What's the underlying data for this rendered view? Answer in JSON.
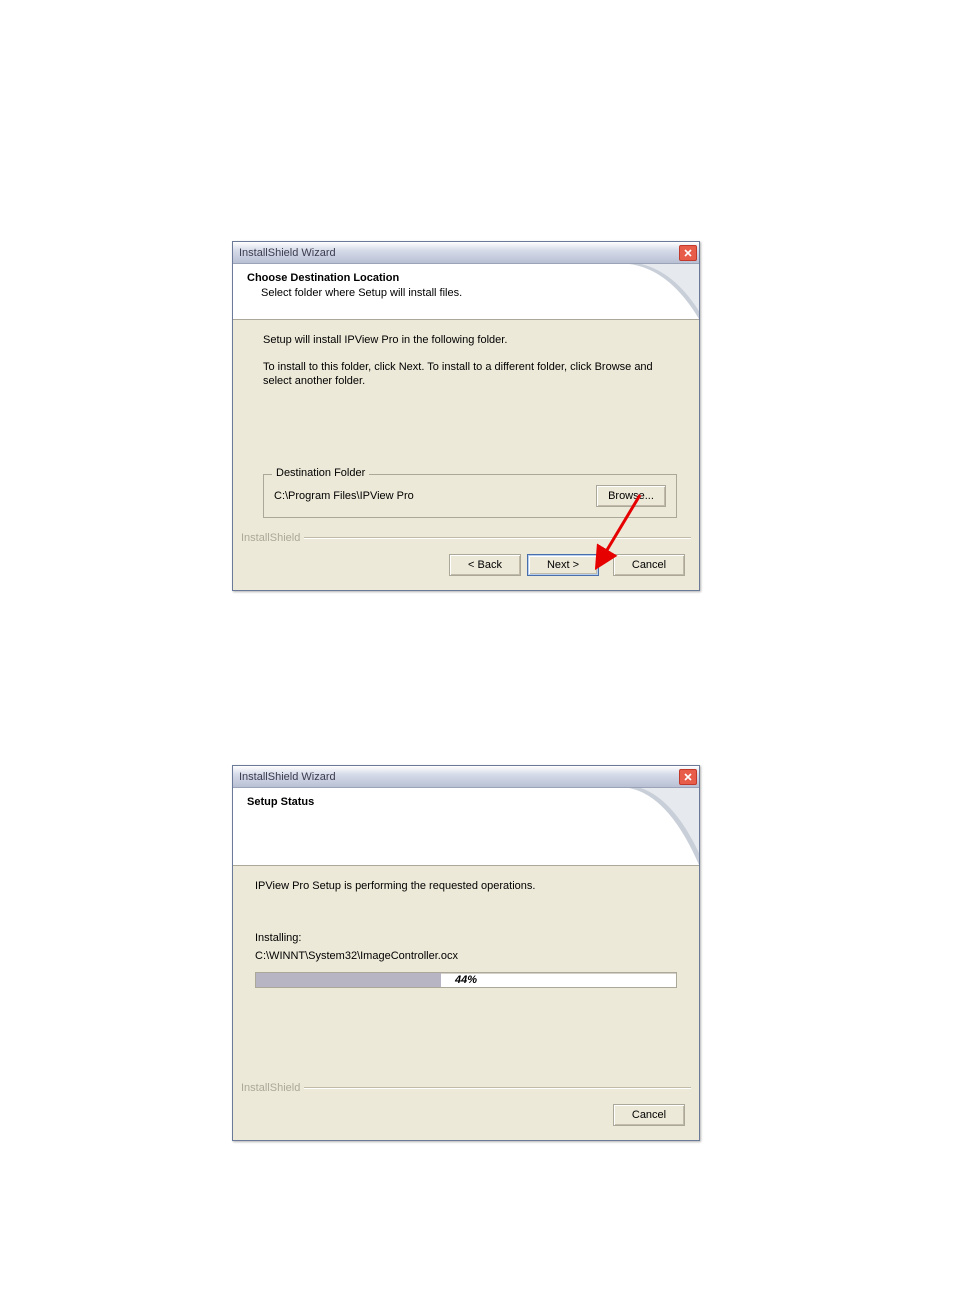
{
  "dialog1": {
    "title": "InstallShield Wizard",
    "header_title": "Choose Destination Location",
    "header_sub": "Select folder where Setup will install files.",
    "body_line1": "Setup will install IPView Pro in the following folder.",
    "body_line2": "To install to this folder, click Next. To install to a different folder, click Browse and select another folder.",
    "dest_legend": "Destination Folder",
    "dest_path": "C:\\Program Files\\IPView Pro",
    "browse": "Browse...",
    "footer_brand": "InstallShield",
    "back": "< Back",
    "next": "Next >",
    "cancel": "Cancel"
  },
  "dialog2": {
    "title": "InstallShield Wizard",
    "header_title": "Setup Status",
    "body_line1": "IPView Pro Setup is performing the requested operations.",
    "installing_label": "Installing:",
    "installing_path": "C:\\WINNT\\System32\\ImageController.ocx",
    "progress_percent": 44,
    "progress_text": "44%",
    "footer_brand": "InstallShield",
    "cancel": "Cancel"
  }
}
